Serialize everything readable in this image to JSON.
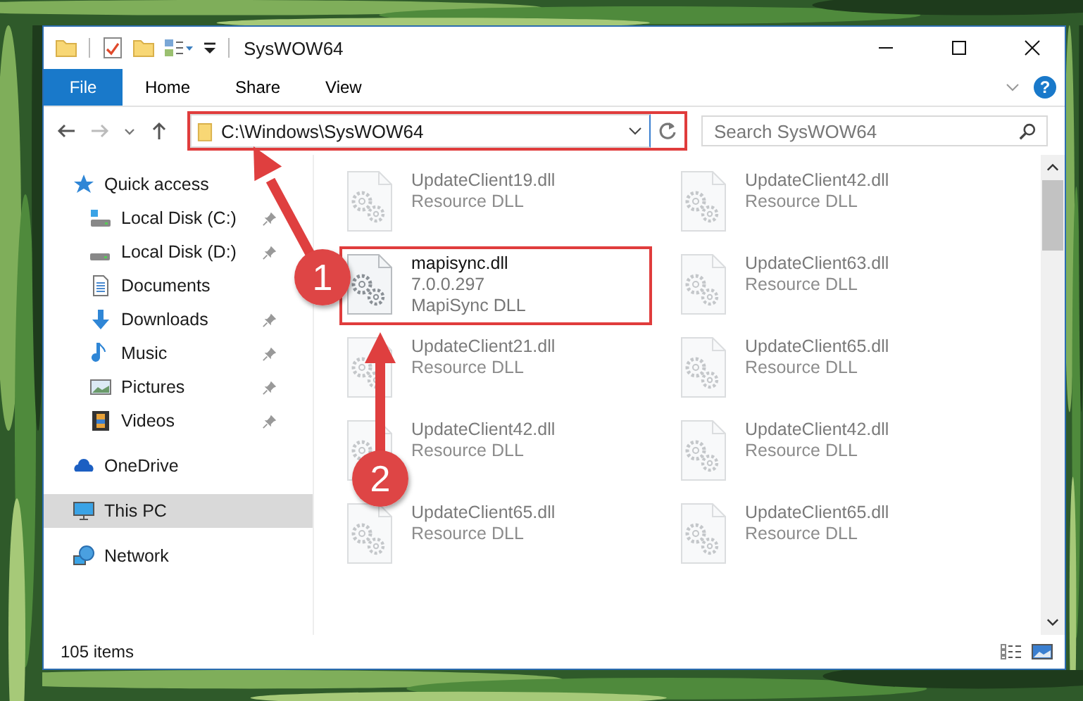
{
  "window": {
    "title": "SysWOW64"
  },
  "ribbon": {
    "file_tab": "File",
    "tabs": [
      {
        "label": "Home"
      },
      {
        "label": "Share"
      },
      {
        "label": "View"
      }
    ],
    "help": "?"
  },
  "address_bar": {
    "path": "C:\\Windows\\SysWOW64",
    "highlighted": true
  },
  "search": {
    "placeholder": "Search SysWOW64"
  },
  "sidebar": {
    "items": [
      {
        "label": "Quick access",
        "kind": "star",
        "selected": false,
        "children": [
          {
            "label": "Local Disk (C:)",
            "kind": "drive-c",
            "pinned": true,
            "selected": false
          },
          {
            "label": "Local Disk (D:)",
            "kind": "drive",
            "pinned": true,
            "selected": false
          },
          {
            "label": "Documents",
            "kind": "documents",
            "pinned": false,
            "selected": false
          },
          {
            "label": "Downloads",
            "kind": "downloads",
            "pinned": true,
            "selected": false
          },
          {
            "label": "Music",
            "kind": "music",
            "pinned": true,
            "selected": false
          },
          {
            "label": "Pictures",
            "kind": "pictures",
            "pinned": true,
            "selected": false
          },
          {
            "label": "Videos",
            "kind": "videos",
            "pinned": true,
            "selected": false
          }
        ]
      },
      {
        "label": "OneDrive",
        "kind": "cloud",
        "selected": false
      },
      {
        "label": "This PC",
        "kind": "pc",
        "selected": true
      },
      {
        "label": "Network",
        "kind": "network",
        "selected": false
      }
    ]
  },
  "files": [
    {
      "name": "UpdateClient19.dll",
      "type": "Resource DLL",
      "blurred": true,
      "highlighted": false
    },
    {
      "name": "UpdateClient42.dll",
      "type": "Resource DLL",
      "blurred": true,
      "highlighted": false
    },
    {
      "name": "mapisync.dll",
      "version": "7.0.0.297",
      "type": "MapiSync DLL",
      "blurred": false,
      "highlighted": true
    },
    {
      "name": "UpdateClient63.dll",
      "type": "Resource DLL",
      "blurred": true,
      "highlighted": false
    },
    {
      "name": "UpdateClient21.dll",
      "type": "Resource DLL",
      "blurred": true,
      "highlighted": false
    },
    {
      "name": "UpdateClient65.dll",
      "type": "Resource DLL",
      "blurred": true,
      "highlighted": false
    },
    {
      "name": "UpdateClient42.dll",
      "type": "Resource DLL",
      "blurred": true,
      "highlighted": false
    },
    {
      "name": "UpdateClient42.dll",
      "type": "Resource DLL",
      "blurred": true,
      "highlighted": false
    },
    {
      "name": "UpdateClient65.dll",
      "type": "Resource DLL",
      "blurred": true,
      "highlighted": false
    },
    {
      "name": "UpdateClient65.dll",
      "type": "Resource DLL",
      "blurred": true,
      "highlighted": false
    }
  ],
  "status_bar": {
    "count": "105 items"
  },
  "callouts": [
    {
      "number": "1"
    },
    {
      "number": "2"
    }
  ]
}
